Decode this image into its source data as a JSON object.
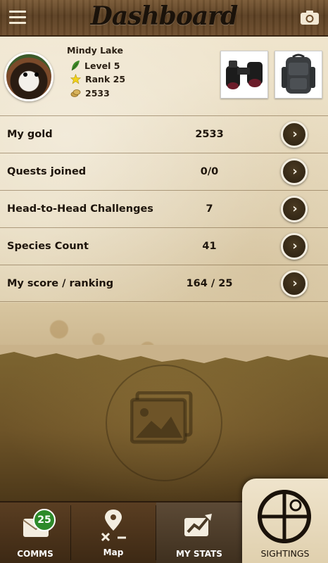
{
  "header": {
    "title": "Dashboard",
    "menu_icon": "hamburger-menu-icon",
    "camera_icon": "camera-icon"
  },
  "profile": {
    "name": "Mindy Lake",
    "level": "Level 5",
    "rank": "Rank 25",
    "gold": "2533",
    "level_icon": "leaf-icon",
    "rank_icon": "star-icon",
    "gold_icon": "gold-coins-icon",
    "gear": [
      "binoculars",
      "backpack"
    ]
  },
  "stats": [
    {
      "label": "My gold",
      "value": "2533"
    },
    {
      "label": "Quests joined",
      "value": "0/0"
    },
    {
      "label": "Head-to-Head Challenges",
      "value": "7"
    },
    {
      "label": "Species Count",
      "value": "41"
    },
    {
      "label": "My score / ranking",
      "value": "164 / 25"
    }
  ],
  "photo_placeholder_icon": "image-icon",
  "tabs": {
    "comms": {
      "label": "COMMS",
      "badge": "25",
      "icon": "mail-icon"
    },
    "map": {
      "label": "Map",
      "icon": "map-pin-icon"
    },
    "my_stats": {
      "label": "MY STATS",
      "icon": "chart-icon"
    },
    "sightings": {
      "label": "SIGHTINGS",
      "icon": "crosshair-icon"
    }
  },
  "colors": {
    "badge": "#2d8a2a",
    "wood": "#5b3f22",
    "paper": "#efe4cc"
  }
}
